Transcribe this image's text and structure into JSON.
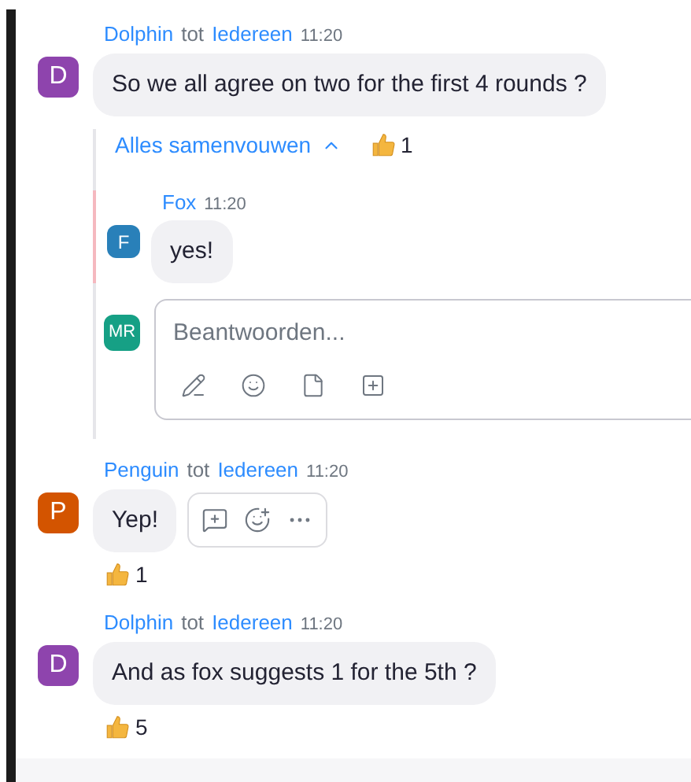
{
  "messages": [
    {
      "sender": "Dolphin",
      "connector": "tot",
      "recipient": "Iedereen",
      "time": "11:20",
      "avatar": "D",
      "color": "#8e44ad",
      "text": "So we all agree on two for the first 4 rounds ?",
      "toolbar_visible": false,
      "thread": {
        "collapse_label": "Alles samenvouwen",
        "reactions": [
          {
            "count": "1"
          }
        ],
        "replies": [
          {
            "sender": "Fox",
            "time": "11:20",
            "avatar": "F",
            "color": "#2980b9",
            "text": "yes!"
          }
        ],
        "composer": {
          "avatar": "MR",
          "placeholder": "Beantwoorden..."
        }
      }
    },
    {
      "sender": "Penguin",
      "connector": "tot",
      "recipient": "Iedereen",
      "time": "11:20",
      "avatar": "P",
      "color": "#d35400",
      "text": "Yep!",
      "toolbar_visible": true,
      "reactions": [
        {
          "count": "1"
        }
      ]
    },
    {
      "sender": "Dolphin",
      "connector": "tot",
      "recipient": "Iedereen",
      "time": "11:20",
      "avatar": "D",
      "color": "#8e44ad",
      "text": "And as fox suggests 1 for the 5th ?",
      "toolbar_visible": false,
      "reactions": [
        {
          "count": "5"
        }
      ]
    }
  ]
}
